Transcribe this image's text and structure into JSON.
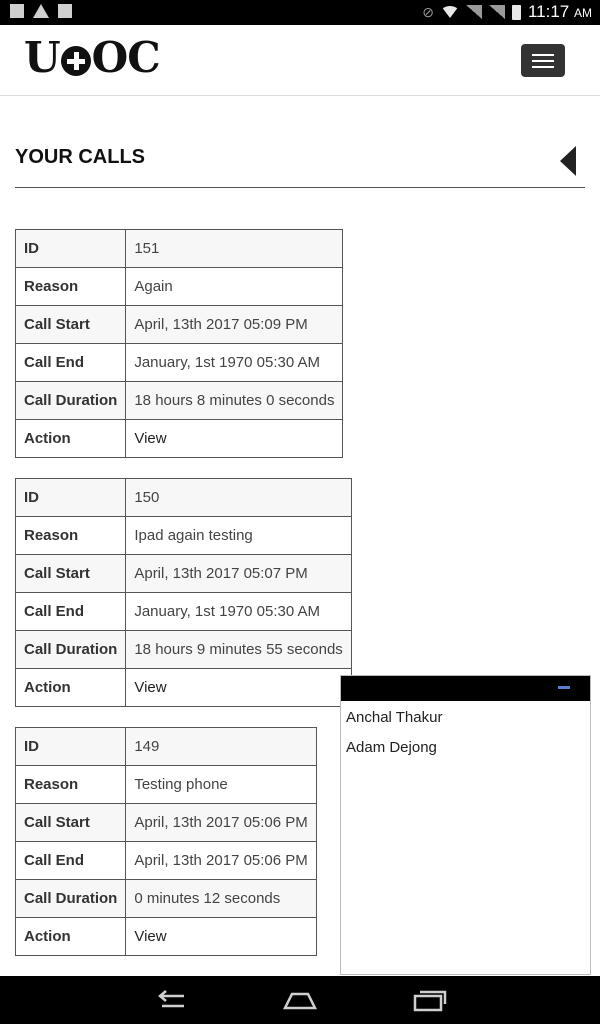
{
  "status_bar": {
    "time": "11:17",
    "ampm": "AM"
  },
  "brand": {
    "logo_left": "U",
    "logo_right": "OC"
  },
  "page": {
    "title": "YOUR CALLS"
  },
  "calls": [
    {
      "id": "151",
      "reason": "Again",
      "call_start": "April, 13th 2017 05:09 PM",
      "call_end": "January, 1st 1970 05:30 AM",
      "call_duration": "18 hours 8 minutes 0 seconds",
      "action": "View"
    },
    {
      "id": "150",
      "reason": "Ipad again testing",
      "call_start": "April, 13th 2017 05:07 PM",
      "call_end": "January, 1st 1970 05:30 AM",
      "call_duration": "18 hours 9 minutes 55 seconds",
      "action": "View"
    },
    {
      "id": "149",
      "reason": "Testing phone",
      "call_start": "April, 13th 2017 05:06 PM",
      "call_end": "April, 13th 2017 05:06 PM",
      "call_duration": "0 minutes 12 seconds",
      "action": "View"
    }
  ],
  "labels": {
    "id": "ID",
    "reason": "Reason",
    "call_start": "Call Start",
    "call_end": "Call End",
    "call_duration": "Call Duration",
    "action": "Action"
  },
  "chat": {
    "contacts": [
      "Anchal Thakur",
      "Adam Dejong"
    ]
  },
  "icons": {
    "status_left": [
      "image-icon",
      "warning-icon",
      "clipboard-icon"
    ],
    "status_right": [
      "mute-icon",
      "wifi-icon",
      "signal-icon",
      "signal-icon",
      "battery-icon"
    ],
    "nav": [
      "back-icon",
      "home-icon",
      "recent-apps-icon"
    ]
  }
}
